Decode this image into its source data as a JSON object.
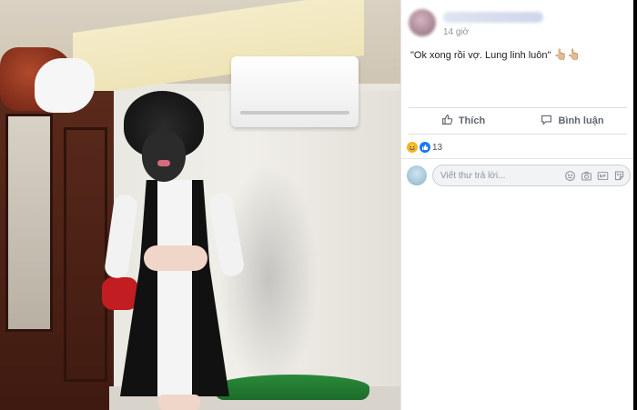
{
  "post": {
    "author_name": "",
    "timestamp": "14 giờ",
    "text": "\"Ok xong rồi vợ. Lung linh luôn\"",
    "text_emojis": "👆🏼👆🏼"
  },
  "actions": {
    "like_label": "Thích",
    "comment_label": "Bình luận"
  },
  "reactions": {
    "count": "13",
    "icons": [
      "haha-icon",
      "like-icon"
    ]
  },
  "comment_input": {
    "placeholder": "Viết thư trả lời..."
  },
  "colors": {
    "brand_blue": "#1877f2",
    "muted_text": "#8d949e",
    "action_text": "#606770"
  }
}
